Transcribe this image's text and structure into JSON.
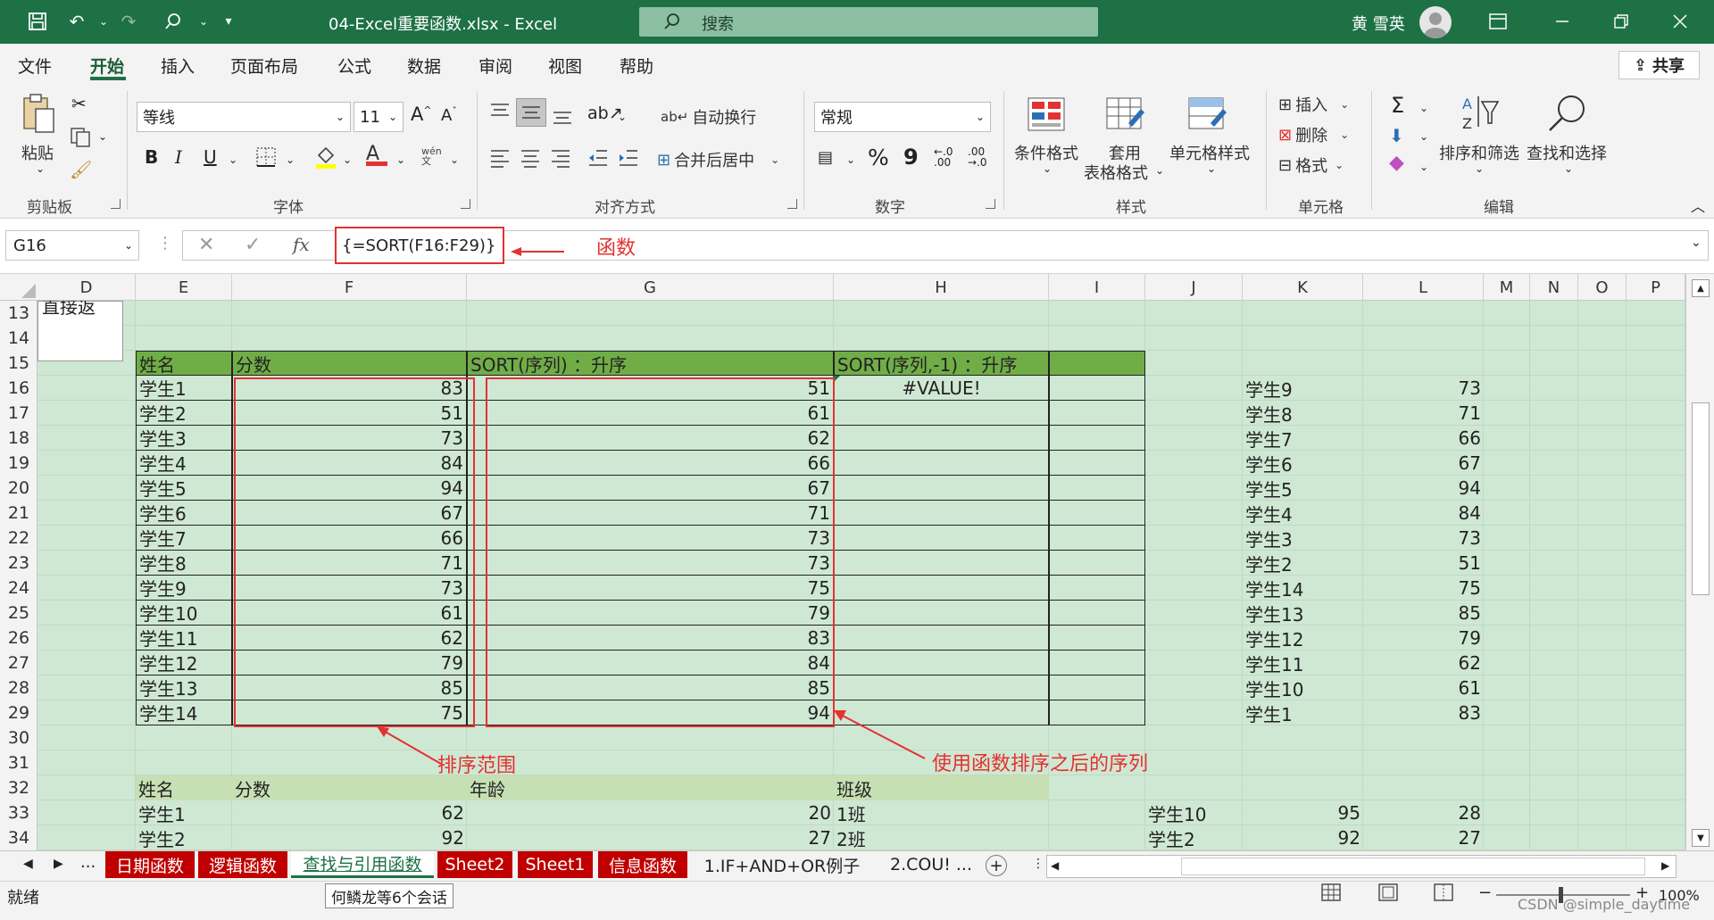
{
  "window": {
    "title": "04-Excel重要函数.xlsx - Excel",
    "search_placeholder": "搜索",
    "user_name": "黄 雪英"
  },
  "menu_tabs": [
    "文件",
    "开始",
    "插入",
    "页面布局",
    "公式",
    "数据",
    "审阅",
    "视图",
    "帮助"
  ],
  "share_label": "共享",
  "ribbon": {
    "clipboard": {
      "paste": "粘贴",
      "group": "剪贴板"
    },
    "font": {
      "name": "等线",
      "size": "11",
      "group": "字体",
      "grow": "A",
      "shrink": "A",
      "bold": "B",
      "italic": "I",
      "underline": "U",
      "phonetic": "wén"
    },
    "alignment": {
      "wrap": "自动换行",
      "merge": "合并后居中",
      "group": "对齐方式"
    },
    "number": {
      "format": "常规",
      "percent": "%",
      "comma": "9",
      "group": "数字"
    },
    "styles": {
      "cond": "条件格式",
      "table1": "套用",
      "table2": "表格格式",
      "cell": "单元格样式",
      "group": "样式"
    },
    "cells": {
      "insert": "插入",
      "delete": "删除",
      "format": "格式",
      "group": "单元格"
    },
    "editing": {
      "sort": "排序和筛选",
      "find": "查找和选择",
      "group": "编辑"
    }
  },
  "formula_bar": {
    "name_box": "G16",
    "formula": "{=SORT(F16:F29)}",
    "fx": "fx"
  },
  "columns": [
    "D",
    "E",
    "F",
    "G",
    "H",
    "I",
    "J",
    "K",
    "L",
    "M",
    "N",
    "O",
    "P"
  ],
  "rows": [
    "13",
    "14",
    "15",
    "16",
    "17",
    "18",
    "19",
    "20",
    "21",
    "22",
    "23",
    "24",
    "25",
    "26",
    "27",
    "28",
    "29",
    "30",
    "31",
    "32",
    "33",
    "34"
  ],
  "cell_d13": "直接返",
  "table": {
    "headers": [
      "姓名",
      "分数",
      "SORT(序列) ：升序",
      "SORT(序列,-1) ：升序"
    ],
    "names": [
      "学生1",
      "学生2",
      "学生3",
      "学生4",
      "学生5",
      "学生6",
      "学生7",
      "学生8",
      "学生9",
      "学生10",
      "学生11",
      "学生12",
      "学生13",
      "学生14"
    ],
    "scores": [
      "83",
      "51",
      "73",
      "84",
      "94",
      "67",
      "66",
      "71",
      "73",
      "61",
      "62",
      "79",
      "85",
      "75"
    ],
    "sorted": [
      "51",
      "61",
      "62",
      "66",
      "67",
      "71",
      "73",
      "73",
      "75",
      "79",
      "83",
      "84",
      "85",
      "94"
    ],
    "h16": "#VALUE!"
  },
  "right_list": {
    "names": [
      "学生9",
      "学生8",
      "学生7",
      "学生6",
      "学生5",
      "学生4",
      "学生3",
      "学生2",
      "学生14",
      "学生13",
      "学生12",
      "学生11",
      "学生10",
      "学生1"
    ],
    "scores": [
      "73",
      "71",
      "66",
      "67",
      "94",
      "84",
      "73",
      "51",
      "75",
      "85",
      "79",
      "62",
      "61",
      "83"
    ]
  },
  "lower_table": {
    "headers": [
      "姓名",
      "分数",
      "年龄",
      "班级"
    ],
    "rows": [
      {
        "name": "学生1",
        "score": "62",
        "age": "20",
        "cls": "1班"
      },
      {
        "name": "学生2",
        "score": "92",
        "age": "27",
        "cls": "2班"
      }
    ],
    "right": [
      {
        "name": "学生10",
        "score": "95",
        "age": "28"
      },
      {
        "name": "学生2",
        "score": "92",
        "age": "27"
      }
    ]
  },
  "annotations": {
    "func": "函数",
    "range": "排序范围",
    "result": "使用函数排序之后的序列"
  },
  "sheet_tabs": [
    {
      "label": "日期函数",
      "style": "red"
    },
    {
      "label": "逻辑函数",
      "style": "red"
    },
    {
      "label": "查找与引用函数",
      "style": "active"
    },
    {
      "label": "Sheet2",
      "style": "red"
    },
    {
      "label": "Sheet1",
      "style": "red"
    },
    {
      "label": "信息函数",
      "style": "red"
    },
    {
      "label": "1.IF+AND+OR例子",
      "style": "plain"
    },
    {
      "label": "2.COU! ...",
      "style": "plain"
    }
  ],
  "status": {
    "ready": "就绪",
    "tooltip": "何鳞龙等6个会话",
    "zoom": "100%",
    "watermark": "CSDN @simple_daytime",
    "ellipsis": "..."
  },
  "colors": {
    "excel_green": "#1e7145",
    "header_green": "#70ad47",
    "cell_green": "#cfe8d3",
    "annotation_red": "#e43131",
    "tab_red": "#c00000"
  }
}
